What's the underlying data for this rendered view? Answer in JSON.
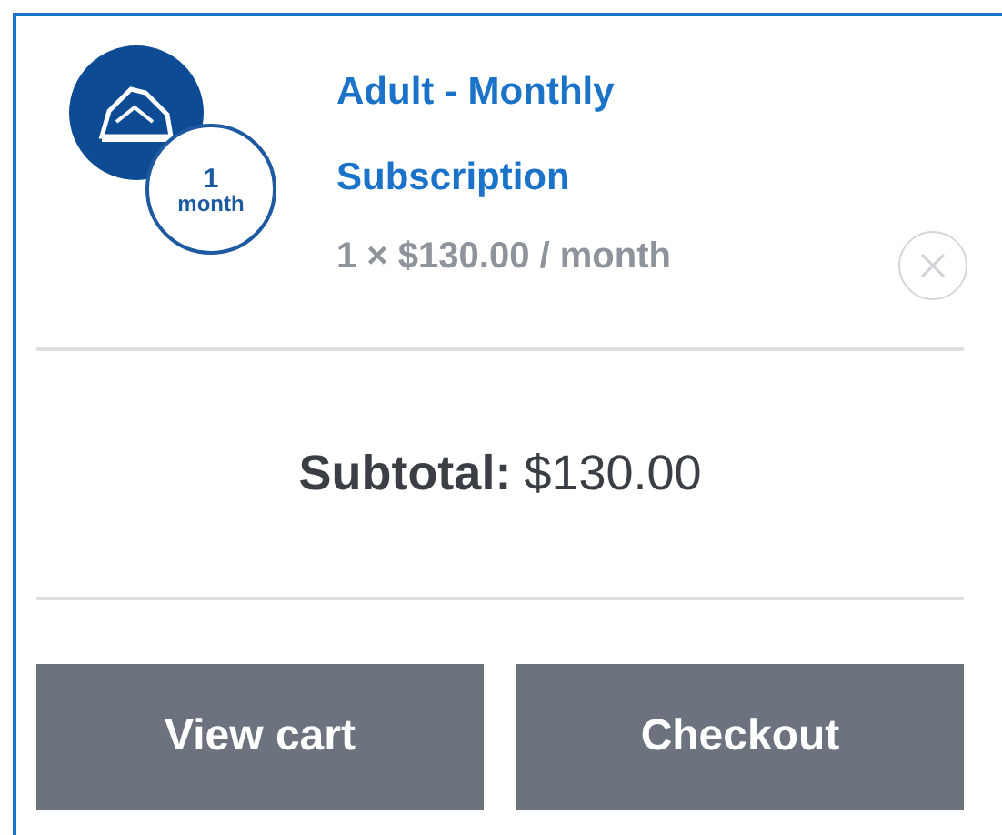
{
  "item": {
    "badge_number": "1",
    "badge_unit": "month",
    "title": "Adult - Monthly Subscription",
    "price": "1 × $130.00 / month"
  },
  "subtotal": {
    "label": "Subtotal:",
    "amount": "$130.00"
  },
  "buttons": [
    {
      "label": "View cart"
    },
    {
      "label": "Checkout"
    }
  ]
}
